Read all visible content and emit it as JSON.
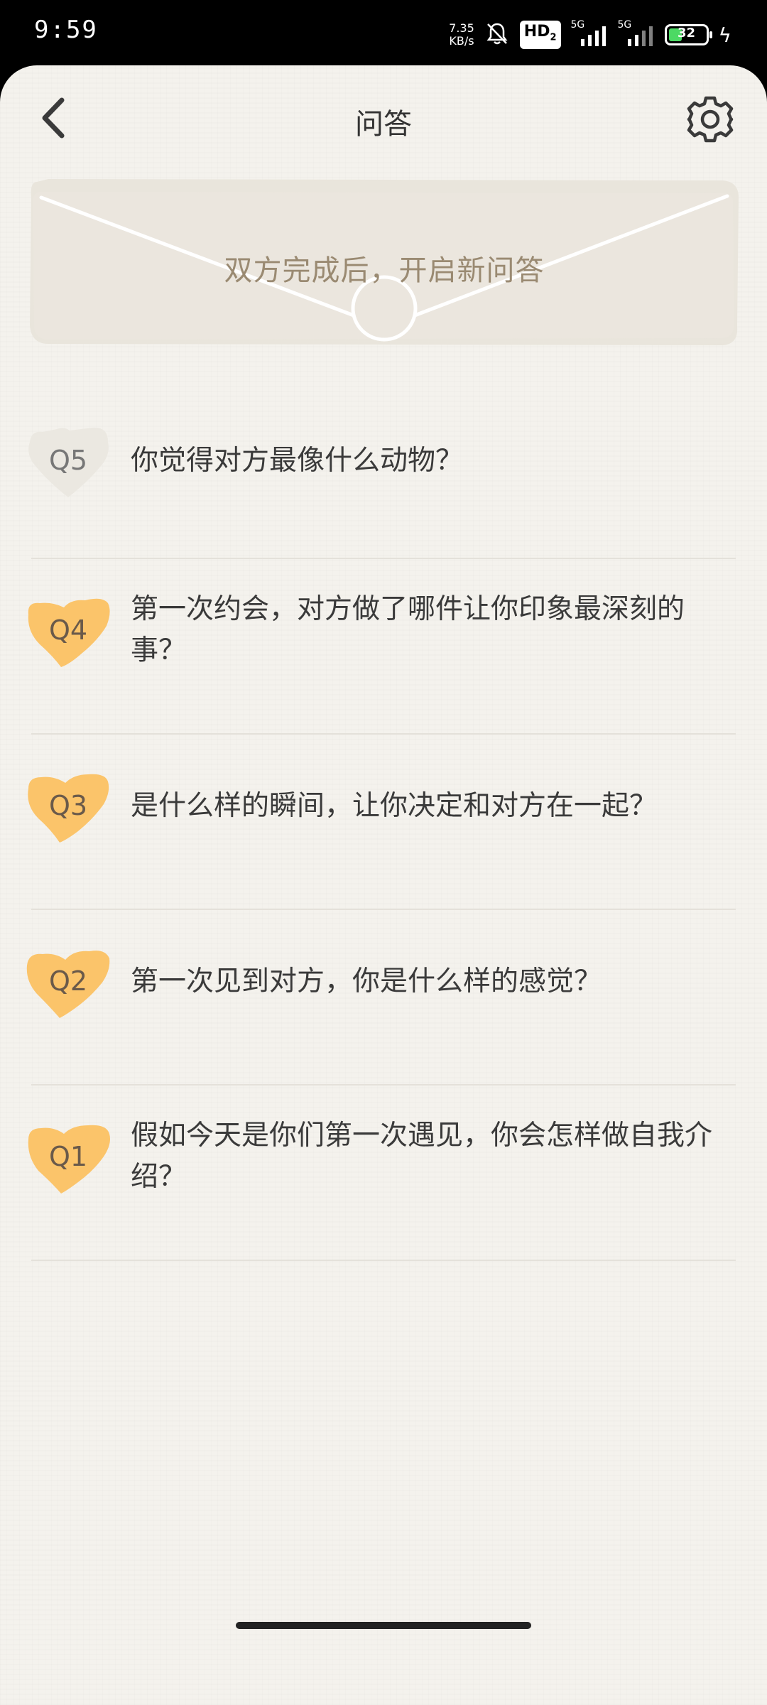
{
  "status_bar": {
    "time": "9:59",
    "net_speed_value": "7.35",
    "net_speed_unit": "KB/s",
    "hd_label": "HD",
    "hd_sub": "2",
    "signal1_label": "5G",
    "signal2_label": "5G",
    "battery_level": "32",
    "icons": [
      "mute-bell-icon",
      "signal-icon",
      "battery-icon",
      "charging-icon"
    ]
  },
  "header": {
    "title": "问答",
    "back_icon": "chevron-left-icon",
    "settings_icon": "gear-icon"
  },
  "envelope": {
    "message": "双方完成后，开启新问答"
  },
  "colors": {
    "background": "#f4f2ed",
    "active_badge": "#fbc46a",
    "inactive_badge": "#ebe8e1",
    "envelope": "#e9e5dc",
    "envelope_text": "#9a8a72"
  },
  "questions": [
    {
      "number": "Q5",
      "text": "你觉得对方最像什么动物？",
      "answered": false
    },
    {
      "number": "Q4",
      "text": "第一次约会，对方做了哪件让你印象最深刻的事？",
      "answered": true
    },
    {
      "number": "Q3",
      "text": "是什么样的瞬间，让你决定和对方在一起？",
      "answered": true
    },
    {
      "number": "Q2",
      "text": "第一次见到对方，你是什么样的感觉？",
      "answered": true
    },
    {
      "number": "Q1",
      "text": "假如今天是你们第一次遇见，你会怎样做自我介绍？",
      "answered": true
    }
  ]
}
